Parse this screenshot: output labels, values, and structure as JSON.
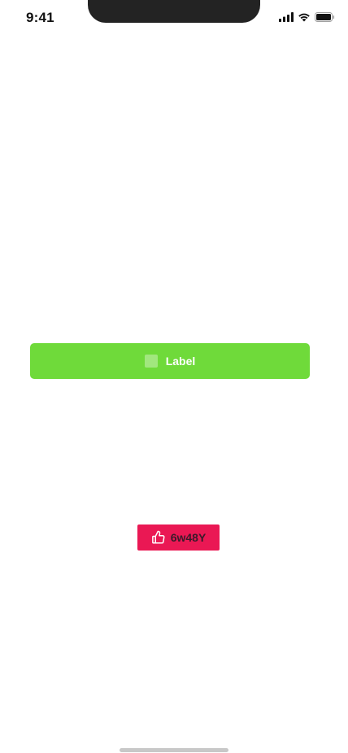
{
  "status_bar": {
    "time": "9:41",
    "icons": [
      "cellular-signal-icon",
      "wifi-icon",
      "battery-icon"
    ]
  },
  "primary_button": {
    "label": "Label",
    "color": "#6FDA3A"
  },
  "like_chip": {
    "label": "6w48Y",
    "color": "#EA1854",
    "icon": "thumbs-up-icon"
  }
}
